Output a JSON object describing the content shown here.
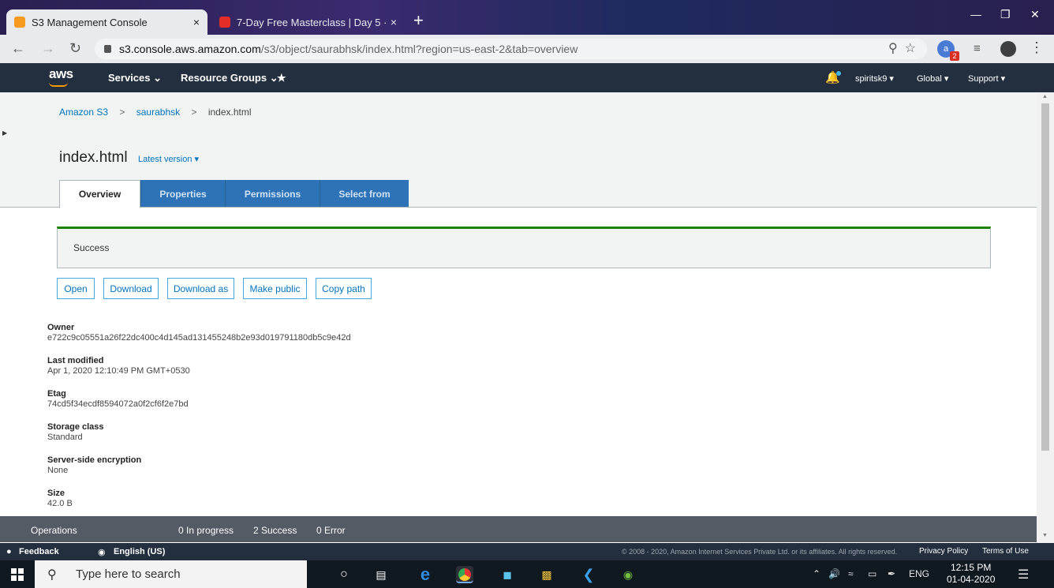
{
  "browser": {
    "tabs": [
      {
        "title": "S3 Management Console",
        "close": "×"
      },
      {
        "title": "7-Day Free Masterclass | Day 5 ·",
        "close": "×"
      }
    ],
    "new_tab": "+",
    "window_controls": {
      "minimize": "—",
      "restore": "❐",
      "close": "✕"
    },
    "url_host": "s3.console.aws.amazon.com",
    "url_path": "/s3/object/saurabhsk/index.html?region=us-east-2&tab=overview",
    "extension_badge": "2"
  },
  "aws_header": {
    "logo": "aws",
    "services": "Services ⌄",
    "resource_groups": "Resource Groups ⌄",
    "pin": "★",
    "user": "spiritsk9 ▾",
    "region": "Global ▾",
    "support": "Support ▾"
  },
  "breadcrumb": {
    "root": "Amazon S3",
    "bucket": "saurabhsk",
    "object": "index.html",
    "sep": ">"
  },
  "page": {
    "title": "index.html",
    "version": "Latest version ▾"
  },
  "tabs": [
    "Overview",
    "Properties",
    "Permissions",
    "Select from"
  ],
  "flash": {
    "message": "Success"
  },
  "actions": [
    "Open",
    "Download",
    "Download as",
    "Make public",
    "Copy path"
  ],
  "properties": [
    {
      "key": "Owner",
      "value": "e722c9c05551a26f22dc400c4d145ad131455248b2e93d019791180db5c9e42d"
    },
    {
      "key": "Last modified",
      "value": "Apr 1, 2020 12:10:49 PM GMT+0530"
    },
    {
      "key": "Etag",
      "value": "74cd5f34ecdf8594072a0f2cf6f2e7bd"
    },
    {
      "key": "Storage class",
      "value": "Standard"
    },
    {
      "key": "Server-side encryption",
      "value": "None"
    },
    {
      "key": "Size",
      "value": "42.0 B"
    }
  ],
  "operations": {
    "label": "Operations",
    "in_progress": "0 In progress",
    "success": "2 Success",
    "error": "0 Error"
  },
  "footer": {
    "feedback": "Feedback",
    "language": "English (US)",
    "copyright": "© 2008 - 2020, Amazon Internet Services Private Ltd. or its affiliates. All rights reserved.",
    "privacy": "Privacy Policy",
    "terms": "Terms of Use"
  },
  "taskbar": {
    "search_placeholder": "Type here to search",
    "lang": "ENG",
    "time": "12:15 PM",
    "date": "01-04-2020"
  },
  "colors": {
    "aws_dark": "#232f3e",
    "link": "#0073bb",
    "success": "#1d8102",
    "tab_blue": "#2e73b8"
  }
}
